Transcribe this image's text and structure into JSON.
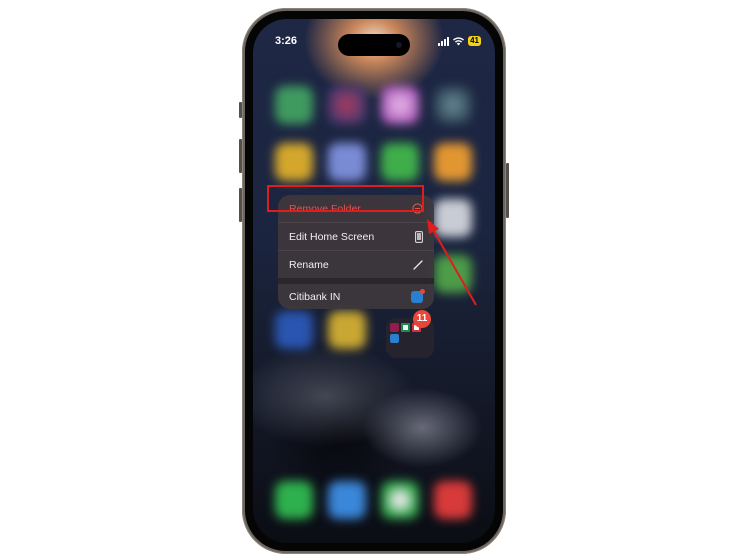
{
  "status_bar": {
    "time": "3:26",
    "battery": "41",
    "battery_mode_color": "#f2d21a"
  },
  "context_menu": {
    "items": [
      {
        "label": "Remove Folder",
        "icon": "minus-circle-icon",
        "destructive": true,
        "color": "#e3544c"
      },
      {
        "label": "Edit Home Screen",
        "icon": "phone-screen-icon"
      },
      {
        "label": "Rename",
        "icon": "pencil-icon"
      },
      {
        "label": "Citibank IN",
        "icon": "citibank-app-icon",
        "has_notification_dot": true
      }
    ]
  },
  "folder": {
    "badge_count": "11",
    "apps": [
      "axis-bank-icon",
      "standard-chartered-icon",
      "icici-icon",
      "citibank-icon"
    ]
  },
  "annotation": {
    "highlight_color": "#e01c1c",
    "highlighted_item": "Remove Folder"
  },
  "dock": {
    "apps": [
      "phone-icon",
      "safari-icon",
      "messages-icon",
      "music-icon"
    ]
  }
}
